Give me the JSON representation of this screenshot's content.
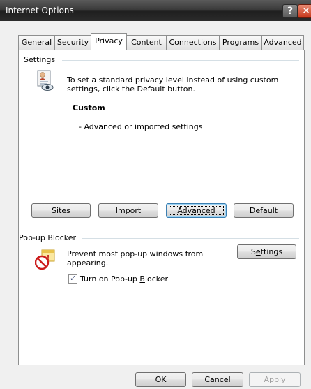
{
  "window": {
    "title": "Internet Options"
  },
  "titlebar": {
    "help_label": "?",
    "close_label": "✕"
  },
  "tabs": [
    {
      "label": "General"
    },
    {
      "label": "Security"
    },
    {
      "label": "Privacy",
      "active": true
    },
    {
      "label": "Content"
    },
    {
      "label": "Connections"
    },
    {
      "label": "Programs"
    },
    {
      "label": "Advanced"
    }
  ],
  "settings": {
    "group_label": "Settings",
    "description_line1": "To set a standard privacy level instead of using custom",
    "description_line2": "settings, click the Default button.",
    "level_name": "Custom",
    "level_detail": "- Advanced or imported settings",
    "buttons": {
      "sites": {
        "accel": "S",
        "rest": "ites"
      },
      "import": {
        "accel": "I",
        "rest": "mport"
      },
      "advanced": {
        "pre": "Ad",
        "accel": "v",
        "rest": "anced"
      },
      "default": {
        "accel": "D",
        "rest": "efault"
      }
    }
  },
  "popup": {
    "group_label": "Pop-up Blocker",
    "description_line1": "Prevent most pop-up windows from",
    "description_line2": "appearing.",
    "settings_button": {
      "pre": "S",
      "accel": "e",
      "rest": "ttings"
    },
    "checkbox": {
      "checked": true,
      "pre": "Turn on Pop-up ",
      "accel": "B",
      "rest": "locker"
    }
  },
  "footer": {
    "ok_label": "OK",
    "cancel_label": "Cancel",
    "apply": {
      "accel": "A",
      "rest": "pply",
      "disabled": true
    }
  },
  "icons": {
    "privacy": "privacy-person-icon",
    "popup": "popup-blocker-icon",
    "check": "checkmark-icon"
  },
  "colors": {
    "titlebar": "#2b2b2b",
    "close": "#c8381c",
    "focus": "#3c7fb1"
  }
}
